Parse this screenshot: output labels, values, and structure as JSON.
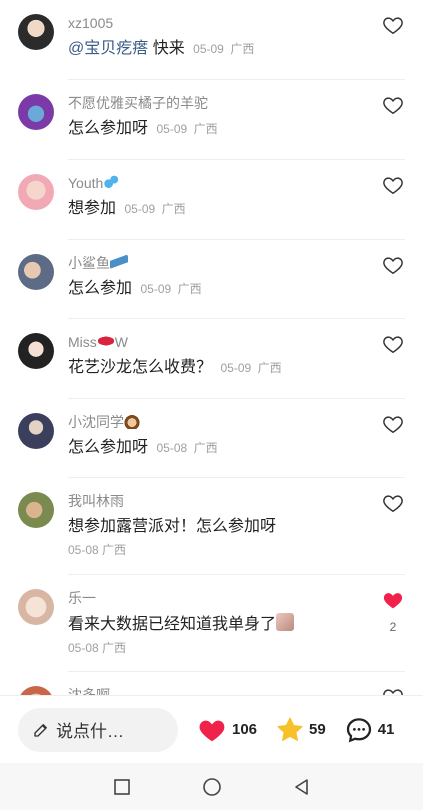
{
  "comments": [
    {
      "name": "xz1005",
      "mention": "@宝贝疙瘩",
      "text": " 快来",
      "date": "05-09",
      "region": "广西",
      "liked": false,
      "like_count": ""
    },
    {
      "name": "不愿优雅买橘子的羊驼",
      "text": "怎么参加呀",
      "date": "05-09",
      "region": "广西",
      "liked": false,
      "like_count": ""
    },
    {
      "name": "Youth",
      "name_emoji": "droplets",
      "text": "想参加",
      "date": "05-09",
      "region": "广西",
      "liked": false,
      "like_count": ""
    },
    {
      "name": "小鲨鱼",
      "name_emoji": "shark",
      "text": "怎么参加",
      "date": "05-09",
      "region": "广西",
      "liked": false,
      "like_count": ""
    },
    {
      "name": "Miss",
      "name_suffix": "W",
      "name_emoji": "lips",
      "text": "花艺沙龙怎么收费？",
      "date": "05-09",
      "region": "广西",
      "liked": false,
      "like_count": ""
    },
    {
      "name": "小沈同学",
      "name_emoji": "girl",
      "text": "怎么参加呀",
      "date": "05-08",
      "region": "广西",
      "liked": false,
      "like_count": ""
    },
    {
      "name": "我叫林雨",
      "text": "想参加露营派对！怎么参加呀",
      "date": "05-08",
      "region": "广西",
      "liked": false,
      "like_count": ""
    },
    {
      "name": "乐一",
      "text": "看来大数据已经知道我单身了",
      "text_emoji": "sticker",
      "date": "05-08",
      "region": "广西",
      "liked": true,
      "like_count": "2"
    },
    {
      "name": "沈多啊",
      "text": "",
      "date": "",
      "region": "",
      "liked": false,
      "like_count": ""
    }
  ],
  "bottom_bar": {
    "input_placeholder": "说点什…",
    "likes": "106",
    "favorites": "59",
    "comments": "41"
  },
  "colors": {
    "like_red": "#f0224a",
    "star_yellow": "#f7c12b",
    "mention_blue": "#3b5b86"
  }
}
